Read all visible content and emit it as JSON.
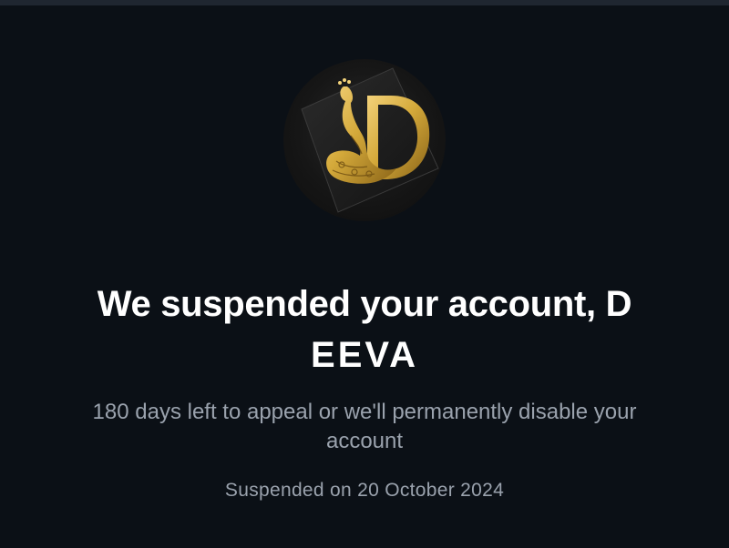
{
  "avatar": {
    "icon": "peacock-monogram-d-logo",
    "accent_color": "#d4a93a",
    "logo_letter": "D"
  },
  "suspension": {
    "title_line1": "We suspended your account, D",
    "title_line2": "EEVA",
    "appeal_message": "180 days left to appeal or we'll permanently disable your account",
    "suspended_date": "Suspended on 20 October 2024"
  },
  "colors": {
    "background": "#0b1016",
    "title": "#ffffff",
    "muted_text": "#9aa2ad"
  }
}
